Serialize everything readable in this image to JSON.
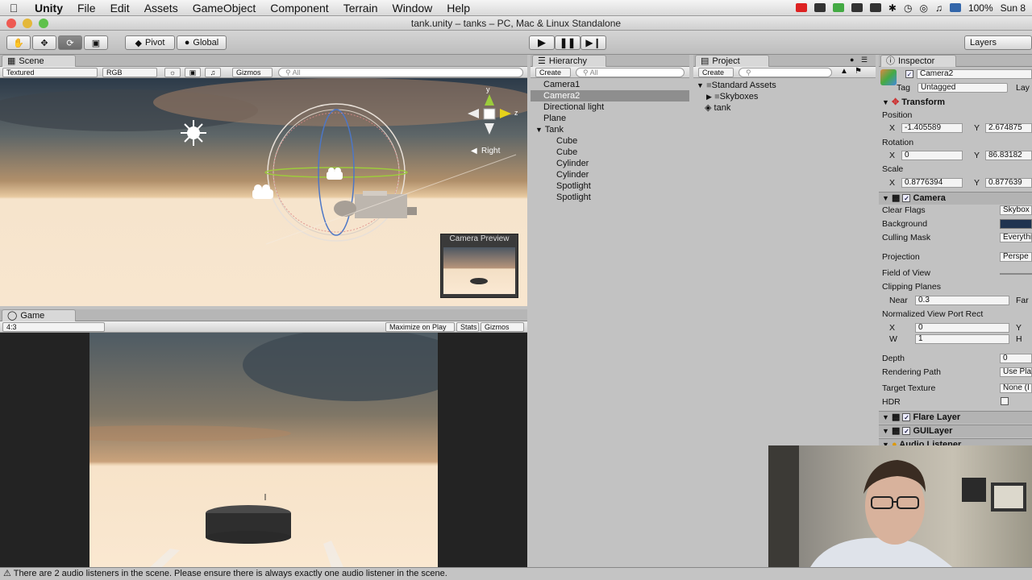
{
  "menubar": {
    "app": "Unity",
    "items": [
      "File",
      "Edit",
      "Assets",
      "GameObject",
      "Component",
      "Terrain",
      "Window",
      "Help"
    ],
    "battery": "100%",
    "clock": "Sun 8"
  },
  "window_title": "tank.unity – tanks – PC, Mac & Linux Standalone",
  "toolbar": {
    "pivot_label": "Pivot",
    "global_label": "Global",
    "layers_label": "Layers"
  },
  "scene": {
    "tab": "Scene",
    "render_mode": "Textured",
    "color_mode": "RGB",
    "gizmos": "Gizmos",
    "search_placeholder": "All",
    "gizmo_axis_y": "y",
    "gizmo_axis_z": "z",
    "view_label": "Right",
    "camera_preview_title": "Camera Preview"
  },
  "game": {
    "tab": "Game",
    "aspect": "4:3",
    "maximize": "Maximize on Play",
    "stats": "Stats",
    "gizmos": "Gizmos"
  },
  "hierarchy": {
    "tab": "Hierarchy",
    "create": "Create",
    "search_placeholder": "All",
    "items": [
      {
        "label": "Camera1",
        "selected": false
      },
      {
        "label": "Camera2",
        "selected": true
      },
      {
        "label": "Directional light",
        "selected": false
      },
      {
        "label": "Plane",
        "selected": false
      },
      {
        "label": "Tank",
        "selected": false
      },
      {
        "label": "Cube",
        "selected": false
      },
      {
        "label": "Cube",
        "selected": false
      },
      {
        "label": "Cylinder",
        "selected": false
      },
      {
        "label": "Cylinder",
        "selected": false
      },
      {
        "label": "Spotlight",
        "selected": false
      },
      {
        "label": "Spotlight",
        "selected": false
      }
    ]
  },
  "project": {
    "tab": "Project",
    "create": "Create",
    "items": [
      "Standard Assets",
      "Skyboxes",
      "tank"
    ]
  },
  "inspector": {
    "tab": "Inspector",
    "object_name": "Camera2",
    "tag_label": "Tag",
    "tag_value": "Untagged",
    "layer_label": "Lay",
    "transform": {
      "title": "Transform",
      "position_label": "Position",
      "position_x": "-1.405589",
      "position_y": "2.674875",
      "rotation_label": "Rotation",
      "rotation_x": "0",
      "rotation_y": "86.83182",
      "scale_label": "Scale",
      "scale_x": "0.8776394",
      "scale_y": "0.877639",
      "x_label": "X",
      "y_label": "Y"
    },
    "camera": {
      "title": "Camera",
      "clear_flags_label": "Clear Flags",
      "clear_flags_value": "Skybox",
      "background_label": "Background",
      "background_color": "#1f3350",
      "culling_mask_label": "Culling Mask",
      "culling_mask_value": "Everythi",
      "projection_label": "Projection",
      "projection_value": "Perspe",
      "fov_label": "Field of View",
      "clipping_label": "Clipping Planes",
      "near_label": "Near",
      "near_value": "0.3",
      "far_label": "Far",
      "viewport_label": "Normalized View Port Rect",
      "vp_x_label": "X",
      "vp_x": "0",
      "vp_y_label": "Y",
      "vp_w_label": "W",
      "vp_w": "1",
      "vp_h_label": "H",
      "depth_label": "Depth",
      "depth_value": "0",
      "rendering_path_label": "Rendering Path",
      "rendering_path_value": "Use Play",
      "target_texture_label": "Target Texture",
      "target_texture_value": "None (I",
      "hdr_label": "HDR"
    },
    "components": [
      "Flare Layer",
      "GUILayer",
      "Audio Listener"
    ]
  },
  "status_message": "There are 2 audio listeners in the scene. Please ensure there is always exactly one audio listener in the scene."
}
